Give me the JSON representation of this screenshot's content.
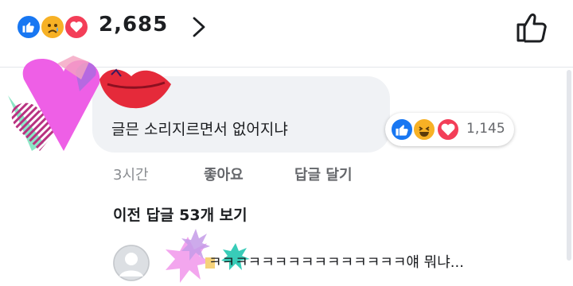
{
  "top_bar": {
    "reaction_count": "2,685",
    "reactions": [
      "like-icon",
      "sad-icon",
      "love-icon"
    ]
  },
  "comment": {
    "text": "글믄 소리지르면서 없어지냐",
    "reaction_count": "1,145",
    "reactions": [
      "like-icon",
      "haha-icon",
      "love-icon"
    ],
    "time": "3시간",
    "like_label": "좋아요",
    "reply_label": "답글 달기"
  },
  "previous_replies": "이전 답글 53개 보기",
  "reply_preview": {
    "text": "ㅋㅋㅋㅋㅋㅋㅋㅋㅋㅋㅋㅋㅋㅋㅋ얘 뭐냐..."
  },
  "colors": {
    "like_blue": "#1877f2",
    "love_red": "#f33e58",
    "emoji_yellow": "#f7b125",
    "bubble_gray": "#f0f2f5"
  }
}
